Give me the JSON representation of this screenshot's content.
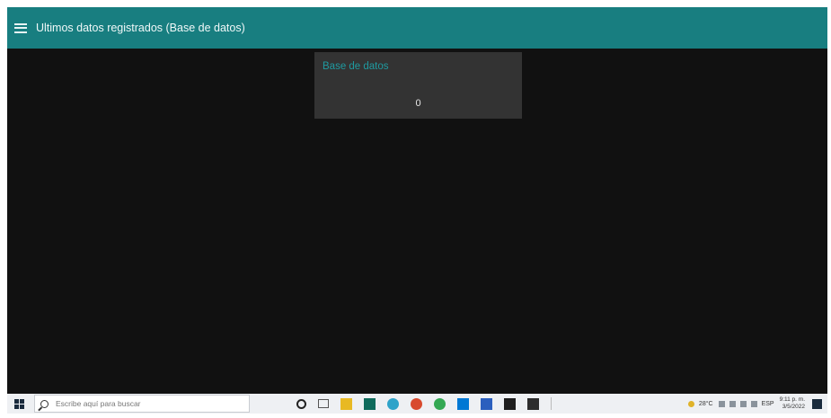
{
  "app": {
    "title": "Ultimos datos registrados (Base de datos)",
    "menu_icon": "hamburger-menu-icon",
    "accent_color": "#187e80"
  },
  "card": {
    "title": "Base de datos",
    "value": "0"
  },
  "taskbar": {
    "search_placeholder": "Escribe aquí para buscar",
    "apps": [
      {
        "icon": "file-explorer-icon",
        "color": "#e8b923"
      },
      {
        "icon": "calculator-icon",
        "color": "#0f6b5c"
      },
      {
        "icon": "edge-icon",
        "color": "#2ea3c9"
      },
      {
        "icon": "app-icon",
        "color": "#d84a2e"
      },
      {
        "icon": "chrome-icon",
        "color": "#34a853"
      },
      {
        "icon": "store-icon",
        "color": "#0078d4"
      },
      {
        "icon": "word-icon",
        "color": "#2b5fbe"
      },
      {
        "icon": "terminal-icon",
        "color": "#1e1e1e"
      },
      {
        "icon": "terminal-icon-2",
        "color": "#2d2d2d"
      }
    ],
    "weather": "28°C",
    "language": "ESP",
    "time": "9:11 p. m.",
    "date": "3/5/2022"
  }
}
